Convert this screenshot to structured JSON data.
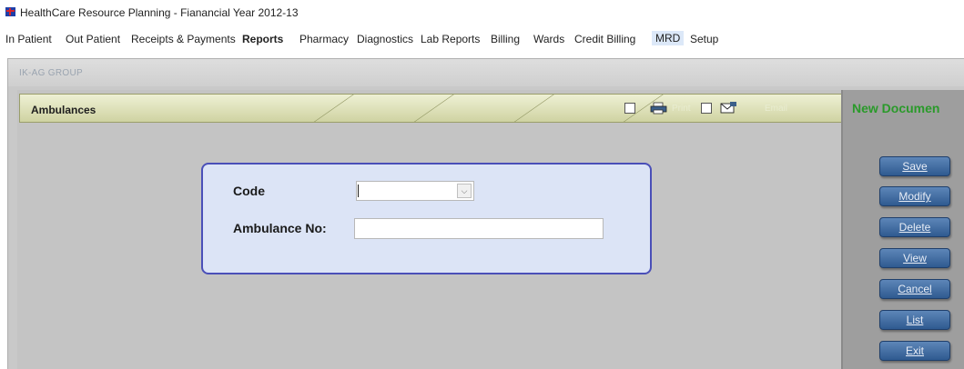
{
  "window": {
    "title": "HealthCare Resource Planning - Fianancial Year 2012-13",
    "app_icon": "app-logo-icon"
  },
  "menu": [
    {
      "label": "In Patient"
    },
    {
      "label": "Out Patient"
    },
    {
      "label": "Receipts & Payments"
    },
    {
      "label": "Reports"
    },
    {
      "label": "Pharmacy"
    },
    {
      "label": "Diagnostics"
    },
    {
      "label": "Lab Reports"
    },
    {
      "label": "Billing"
    },
    {
      "label": "Wards"
    },
    {
      "label": "Credit Billing"
    },
    {
      "label": "MRD"
    },
    {
      "label": "Setup"
    }
  ],
  "group": {
    "label": "IK-AG GROUP"
  },
  "module": {
    "title": "Ambulances",
    "print_label": "Print",
    "email_label": "Email",
    "print_icon": "printer-icon",
    "email_icon": "email-icon"
  },
  "status": {
    "text": "New Documen",
    "color": "#2a9a2a"
  },
  "form": {
    "code_label": "Code",
    "code_value": "",
    "ambulance_label": "Ambulance No:",
    "ambulance_value": ""
  },
  "actions": {
    "save": "Save",
    "modify": "Modify",
    "delete": "Delete",
    "view": "View",
    "cancel": "Cancel",
    "list": "List",
    "exit": "Exit"
  },
  "colors": {
    "button": "#3e6aa0",
    "form_border": "#4a4fb8",
    "form_bg": "#dce4f6",
    "module_bar": "#dfe2b8"
  }
}
